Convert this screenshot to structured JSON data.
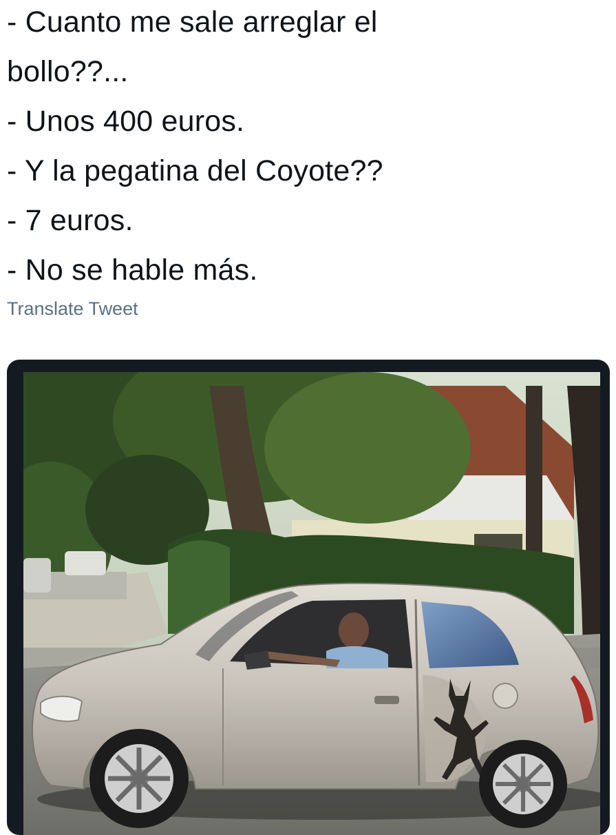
{
  "tweet": {
    "lines": [
      "- Cuanto me sale arreglar el",
      "bollo??...",
      "- Unos 400 euros.",
      "- Y la pegatina del Coyote??",
      "- 7 euros.",
      "- No se hable más."
    ],
    "translate_label": "Translate Tweet"
  },
  "media": {
    "icon": "photo",
    "colors": {
      "frame": "#141a22",
      "car": "#c8c4bc",
      "house_roof": "#8a4a32",
      "foliage": "#2f4a22"
    }
  }
}
